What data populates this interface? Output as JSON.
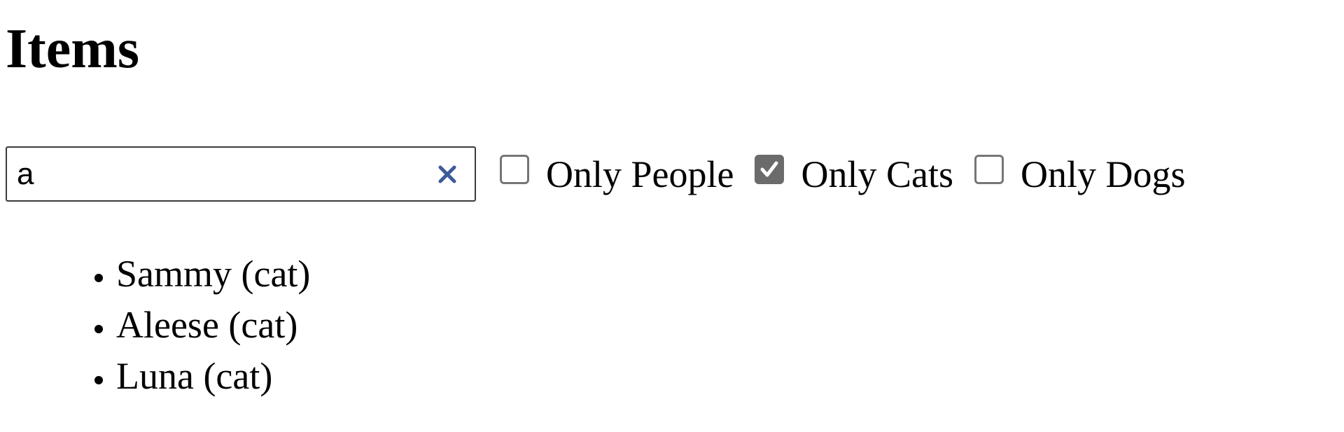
{
  "page": {
    "title": "Items"
  },
  "search": {
    "value": "a",
    "placeholder": "",
    "clear_icon": "close-icon",
    "clear_color": "#3d5a99"
  },
  "filters": [
    {
      "label": "Only People",
      "checked": false
    },
    {
      "label": "Only Cats",
      "checked": true
    },
    {
      "label": "Only Dogs",
      "checked": false
    }
  ],
  "results": [
    {
      "text": "Sammy (cat)"
    },
    {
      "text": "Aleese (cat)"
    },
    {
      "text": "Luna (cat)"
    }
  ],
  "colors": {
    "checkbox_checked": "#6b6b6b",
    "checkbox_border": "#767676"
  }
}
